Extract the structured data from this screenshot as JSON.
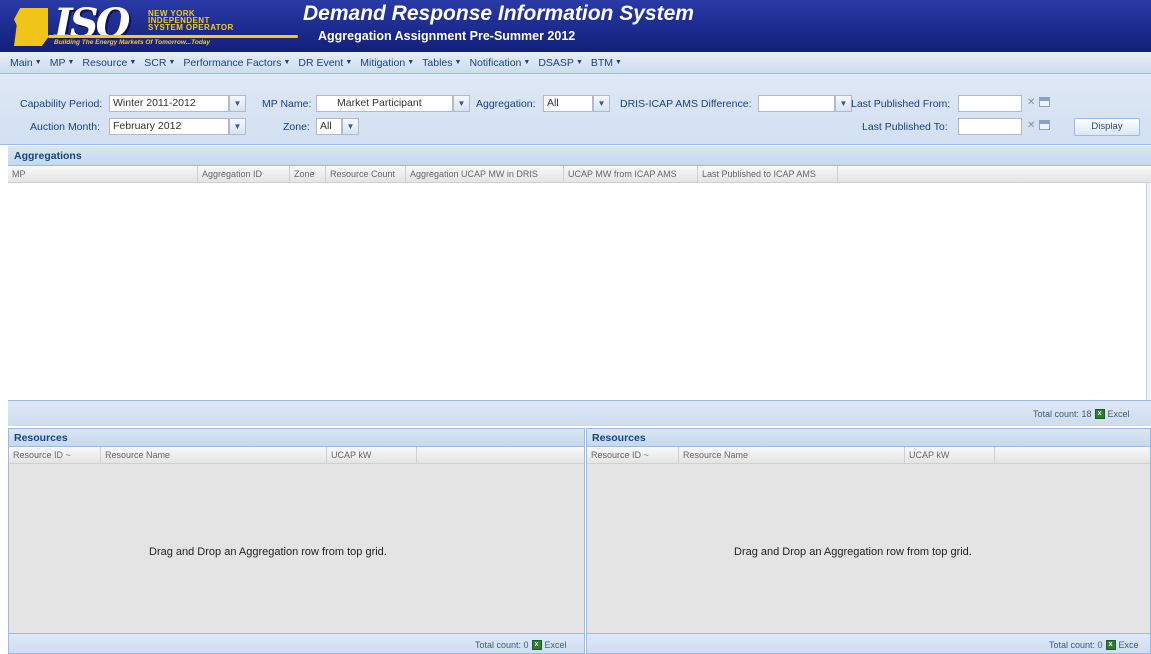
{
  "header": {
    "logo_lines": [
      "NEW YORK",
      "INDEPENDENT",
      "SYSTEM OPERATOR"
    ],
    "logo_tagline": "Building The Energy Markets Of Tomorrow...Today",
    "logo_mark": "ISO",
    "title": "Demand Response Information System",
    "subtitle": "Aggregation Assignment Pre-Summer 2012"
  },
  "menu": [
    "Main",
    "MP",
    "Resource",
    "SCR",
    "Performance Factors",
    "DR Event",
    "Mitigation",
    "Tables",
    "Notification",
    "DSASP",
    "BTM"
  ],
  "filters": {
    "capability_period_label": "Capability Period:",
    "capability_period_value": "Winter 2011-2012",
    "auction_month_label": "Auction Month:",
    "auction_month_value": "February 2012",
    "mp_name_label": "MP Name:",
    "mp_name_value": "Market Participant",
    "zone_label": "Zone:",
    "zone_value": "All",
    "aggregation_label": "Aggregation:",
    "aggregation_value": "All",
    "dris_icap_label": "DRIS-ICAP AMS Difference:",
    "dris_icap_value": "",
    "last_published_from_label": "Last Published From:",
    "last_published_to_label": "Last Published To:",
    "display_button": "Display"
  },
  "aggregations": {
    "title": "Aggregations",
    "columns": [
      "MP",
      "Aggregation ID",
      "Zone",
      "Resource Count",
      "Aggregation UCAP MW in DRIS",
      "UCAP MW from ICAP AMS",
      "Last Published to ICAP AMS"
    ],
    "total_count_label": "Total count: 18",
    "excel_label": "Excel"
  },
  "resources_left": {
    "title": "Resources",
    "columns": [
      "Resource ID ~",
      "Resource Name",
      "UCAP kW"
    ],
    "empty_message": "Drag and Drop an Aggregation row from top grid.",
    "total_count_label": "Total count: 0",
    "excel_label": "Excel"
  },
  "resources_right": {
    "title": "Resources",
    "columns": [
      "Resource ID ~",
      "Resource Name",
      "UCAP kW"
    ],
    "empty_message": "Drag and Drop an Aggregation row from top grid.",
    "total_count_label": "Total count: 0",
    "excel_label": "Exce"
  },
  "colors": {
    "header_blue": "#1c2b8e",
    "logo_gold": "#f4c922",
    "panel_border": "#99bbe8",
    "text_blue": "#15428b"
  },
  "icons": [
    "dropdown-arrow-icon",
    "clear-x-icon",
    "calendar-icon",
    "excel-icon"
  ]
}
